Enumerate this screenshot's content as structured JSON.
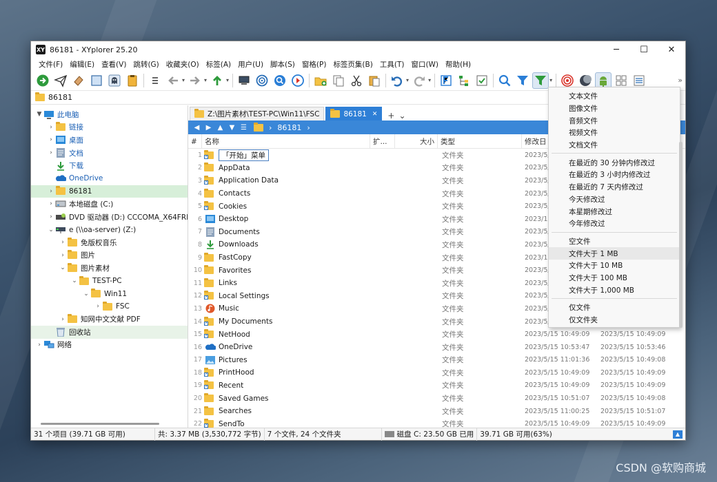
{
  "window": {
    "title": "86181 - XYplorer 25.20",
    "app_icon": "XY"
  },
  "controls": {
    "minimize": "─",
    "maximize": "☐",
    "close": "✕"
  },
  "menu": [
    "文件(F)",
    "编辑(E)",
    "查看(V)",
    "跳转(G)",
    "收藏夹(O)",
    "标签(A)",
    "用户(U)",
    "脚本(S)",
    "窗格(P)",
    "标签页集(B)",
    "工具(T)",
    "窗口(W)",
    "帮助(H)"
  ],
  "address": {
    "path": "86181"
  },
  "tree": [
    {
      "label": "此电脑",
      "icon": "pc-icon",
      "indent": 0,
      "twisty": "▼",
      "blue": true
    },
    {
      "label": "链接",
      "icon": "folder-icon",
      "indent": 1,
      "twisty": "›",
      "blue": true
    },
    {
      "label": "桌面",
      "icon": "desktop-icon",
      "indent": 1,
      "twisty": "›",
      "blue": true
    },
    {
      "label": "文档",
      "icon": "documents-icon",
      "indent": 1,
      "twisty": "›",
      "blue": true
    },
    {
      "label": "下载",
      "icon": "download-icon",
      "indent": 1,
      "twisty": "",
      "blue": true
    },
    {
      "label": "OneDrive",
      "icon": "onedrive-icon",
      "indent": 1,
      "twisty": "",
      "blue": true
    },
    {
      "label": "86181",
      "icon": "folder-icon",
      "indent": 1,
      "twisty": "›",
      "blue": false,
      "selected": true
    },
    {
      "label": "本地磁盘 (C:)",
      "icon": "drive-icon",
      "indent": 1,
      "twisty": "›",
      "blue": false
    },
    {
      "label": "DVD 驱动器 (D:) CCCOMA_X64FRE_ZH-C",
      "icon": "dvd-icon",
      "indent": 1,
      "twisty": "›",
      "blue": false
    },
    {
      "label": "e (\\\\oa-server) (Z:)",
      "icon": "network-drive-icon",
      "indent": 1,
      "twisty": "⌄",
      "blue": false
    },
    {
      "label": "免版权音乐",
      "icon": "folder-icon",
      "indent": 2,
      "twisty": "›",
      "blue": false
    },
    {
      "label": "图片",
      "icon": "folder-icon",
      "indent": 2,
      "twisty": "›",
      "blue": false
    },
    {
      "label": "图片素材",
      "icon": "folder-icon",
      "indent": 2,
      "twisty": "⌄",
      "blue": false
    },
    {
      "label": "TEST-PC",
      "icon": "folder-icon",
      "indent": 3,
      "twisty": "⌄",
      "blue": false
    },
    {
      "label": "Win11",
      "icon": "folder-icon",
      "indent": 4,
      "twisty": "⌄",
      "blue": false
    },
    {
      "label": "FSC",
      "icon": "folder-icon",
      "indent": 5,
      "twisty": "›",
      "blue": false
    },
    {
      "label": "知网中文文献 PDF",
      "icon": "folder-icon",
      "indent": 2,
      "twisty": "›",
      "blue": false
    },
    {
      "label": "回收站",
      "icon": "recycle-bin-icon",
      "indent": 1,
      "twisty": "",
      "blue": false,
      "highlight": true
    },
    {
      "label": "网络",
      "icon": "network-icon",
      "indent": 0,
      "twisty": "›",
      "blue": false
    }
  ],
  "tabs": [
    {
      "label": "Z:\\图片素材\\TEST-PC\\Win11\\FSC",
      "active": false
    },
    {
      "label": "86181",
      "active": true,
      "close": "✕"
    }
  ],
  "tab_add": "+",
  "tab_menu": "⌄",
  "breadcrumb": {
    "segment": "86181",
    "sep": "›"
  },
  "columns": {
    "num": "#",
    "name": "名称",
    "ext": "扩...",
    "size": "大小",
    "type": "类型",
    "modified": "修改日"
  },
  "files": [
    {
      "n": "1",
      "name": "「开始」菜单",
      "icon": "shortcut-folder-icon",
      "type": "文件夹",
      "mod": "2023/5/15",
      "cre": "",
      "editing": true
    },
    {
      "n": "2",
      "name": "AppData",
      "icon": "folder-icon",
      "type": "文件夹",
      "mod": "2023/5/15",
      "cre": ""
    },
    {
      "n": "3",
      "name": "Application Data",
      "icon": "shortcut-folder-icon",
      "type": "文件夹",
      "mod": "2023/5/15",
      "cre": ""
    },
    {
      "n": "4",
      "name": "Contacts",
      "icon": "folder-icon",
      "type": "文件夹",
      "mod": "2023/5/15",
      "cre": ""
    },
    {
      "n": "5",
      "name": "Cookies",
      "icon": "shortcut-folder-icon",
      "type": "文件夹",
      "mod": "2023/5/15",
      "cre": ""
    },
    {
      "n": "6",
      "name": "Desktop",
      "icon": "desktop-icon",
      "type": "文件夹",
      "mod": "2023/11",
      "cre": ""
    },
    {
      "n": "7",
      "name": "Documents",
      "icon": "documents-icon",
      "type": "文件夹",
      "mod": "2023/5/15",
      "cre": ""
    },
    {
      "n": "8",
      "name": "Downloads",
      "icon": "download-icon",
      "type": "文件夹",
      "mod": "2023/5/15",
      "cre": ""
    },
    {
      "n": "9",
      "name": "FastCopy",
      "icon": "folder-icon",
      "type": "文件夹",
      "mod": "2023/11",
      "cre": ""
    },
    {
      "n": "10",
      "name": "Favorites",
      "icon": "folder-icon",
      "type": "文件夹",
      "mod": "2023/5/15",
      "cre": ""
    },
    {
      "n": "11",
      "name": "Links",
      "icon": "folder-icon",
      "type": "文件夹",
      "mod": "2023/5/15",
      "cre": ""
    },
    {
      "n": "12",
      "name": "Local Settings",
      "icon": "shortcut-folder-icon",
      "type": "文件夹",
      "mod": "2023/5/15",
      "cre": ""
    },
    {
      "n": "13",
      "name": "Music",
      "icon": "music-icon",
      "type": "文件夹",
      "mod": "2023/5/15",
      "cre": ""
    },
    {
      "n": "14",
      "name": "My Documents",
      "icon": "shortcut-folder-icon",
      "type": "文件夹",
      "mod": "2023/5/15",
      "cre": ""
    },
    {
      "n": "15",
      "name": "NetHood",
      "icon": "shortcut-folder-icon",
      "type": "文件夹",
      "mod": "2023/5/15 10:49:09",
      "cre": "2023/5/15 10:49:09"
    },
    {
      "n": "16",
      "name": "OneDrive",
      "icon": "onedrive-icon",
      "type": "文件夹",
      "mod": "2023/5/15 10:53:47",
      "cre": "2023/5/15 10:53:46"
    },
    {
      "n": "17",
      "name": "Pictures",
      "icon": "pictures-icon",
      "type": "文件夹",
      "mod": "2023/5/15 11:01:36",
      "cre": "2023/5/15 10:49:08"
    },
    {
      "n": "18",
      "name": "PrintHood",
      "icon": "shortcut-folder-icon",
      "type": "文件夹",
      "mod": "2023/5/15 10:49:09",
      "cre": "2023/5/15 10:49:09"
    },
    {
      "n": "19",
      "name": "Recent",
      "icon": "shortcut-folder-icon",
      "type": "文件夹",
      "mod": "2023/5/15 10:49:09",
      "cre": "2023/5/15 10:49:09"
    },
    {
      "n": "20",
      "name": "Saved Games",
      "icon": "folder-icon",
      "type": "文件夹",
      "mod": "2023/5/15 10:51:07",
      "cre": "2023/5/15 10:49:08"
    },
    {
      "n": "21",
      "name": "Searches",
      "icon": "folder-icon",
      "type": "文件夹",
      "mod": "2023/5/15 11:00:25",
      "cre": "2023/5/15 10:51:07"
    },
    {
      "n": "22",
      "name": "SendTo",
      "icon": "shortcut-folder-icon",
      "type": "文件夹",
      "mod": "2023/5/15 10:49:09",
      "cre": "2023/5/15 10:49:09"
    }
  ],
  "filter_menu": [
    [
      "文本文件",
      "图像文件",
      "音频文件",
      "视频文件",
      "文档文件"
    ],
    [
      "在最近的 30 分钟内修改过",
      "在最近的 3 小时内修改过",
      "在最近的 7 天内修改过",
      "今天修改过",
      "本星期修改过",
      "今年修改过"
    ],
    [
      "空文件",
      "文件大于 1 MB",
      "文件大于 10 MB",
      "文件大于 100 MB",
      "文件大于 1,000 MB"
    ],
    [
      "仅文件",
      "仅文件夹"
    ]
  ],
  "filter_menu_hover": "文件大于 1 MB",
  "status": {
    "items": "31 个项目 (39.71 GB 可用)",
    "total": "共: 3.37 MB (3,530,772 字节)",
    "count": "7 个文件, 24 个文件夹",
    "disk": "磁盘 C: 23.50 GB 已用",
    "free": "39.71 GB 可用(63%)",
    "up": "▲"
  },
  "watermark": "CSDN @软购商城"
}
